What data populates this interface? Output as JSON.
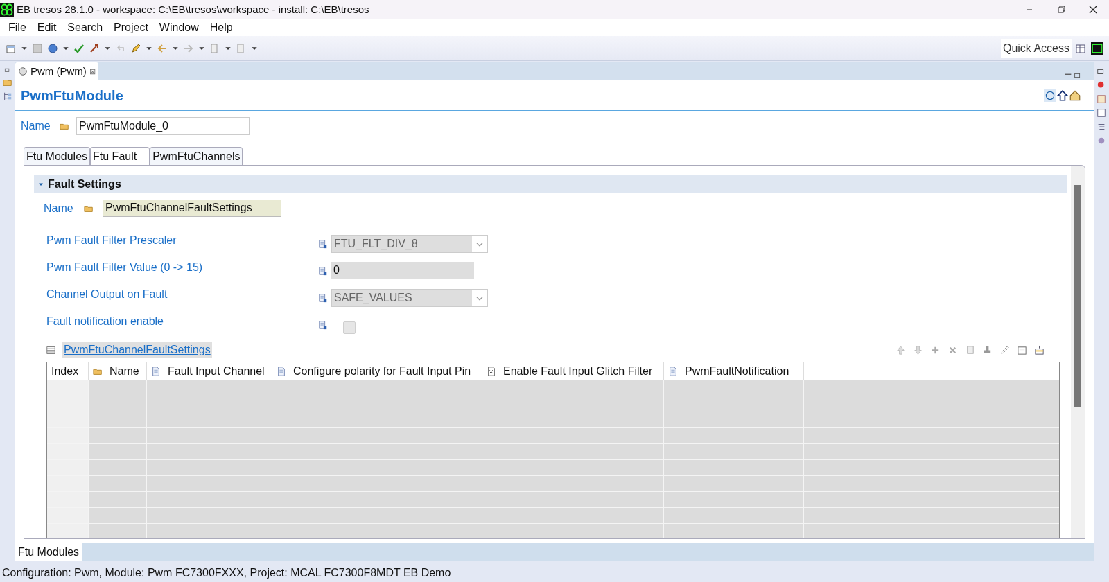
{
  "window": {
    "title": "EB tresos 28.1.0 - workspace: C:\\EB\\tresos\\workspace - install: C:\\EB\\tresos"
  },
  "menu": [
    "File",
    "Edit",
    "Search",
    "Project",
    "Window",
    "Help"
  ],
  "quick_access": "Quick Access",
  "editor_tab": {
    "label": "Pwm (Pwm)",
    "close": "⊠"
  },
  "heading": "PwmFtuModule",
  "name_field": {
    "label": "Name",
    "value": "PwmFtuModule_0"
  },
  "tabs": [
    {
      "label": "Ftu Modules",
      "selected": false
    },
    {
      "label": "Ftu Fault",
      "selected": true
    },
    {
      "label": "PwmFtuChannels",
      "selected": false
    }
  ],
  "section": {
    "title": "Fault Settings",
    "expanded": true,
    "name_label": "Name",
    "name_value": "PwmFtuChannelFaultSettings",
    "params": [
      {
        "kind": "dropdown",
        "label": "Pwm Fault Filter Prescaler",
        "value": "FTU_FLT_DIV_8",
        "disabled": true
      },
      {
        "kind": "text",
        "label": "Pwm Fault Filter Value (0 -> 15)",
        "value": "0",
        "disabled": true
      },
      {
        "kind": "dropdown",
        "label": "Channel Output on Fault",
        "value": "SAFE_VALUES",
        "disabled": true
      },
      {
        "kind": "checkbox",
        "label": "Fault notification enable",
        "checked": false,
        "disabled": true
      }
    ]
  },
  "table": {
    "title": "PwmFtuChannelFaultSettings",
    "columns": [
      {
        "label": "Index"
      },
      {
        "label": "Name"
      },
      {
        "label": "Fault Input Channel"
      },
      {
        "label": "Configure polarity for Fault Input Pin"
      },
      {
        "label": "Enable Fault Input Glitch Filter"
      },
      {
        "label": "PwmFaultNotification"
      }
    ]
  },
  "bottom_tabs": [
    {
      "label": "Ftu Modules",
      "selected": true
    }
  ],
  "status_bar": "Configuration: Pwm, Module: Pwm FC7300FXXX, Project: MCAL FC7300F8MDT EB Demo"
}
